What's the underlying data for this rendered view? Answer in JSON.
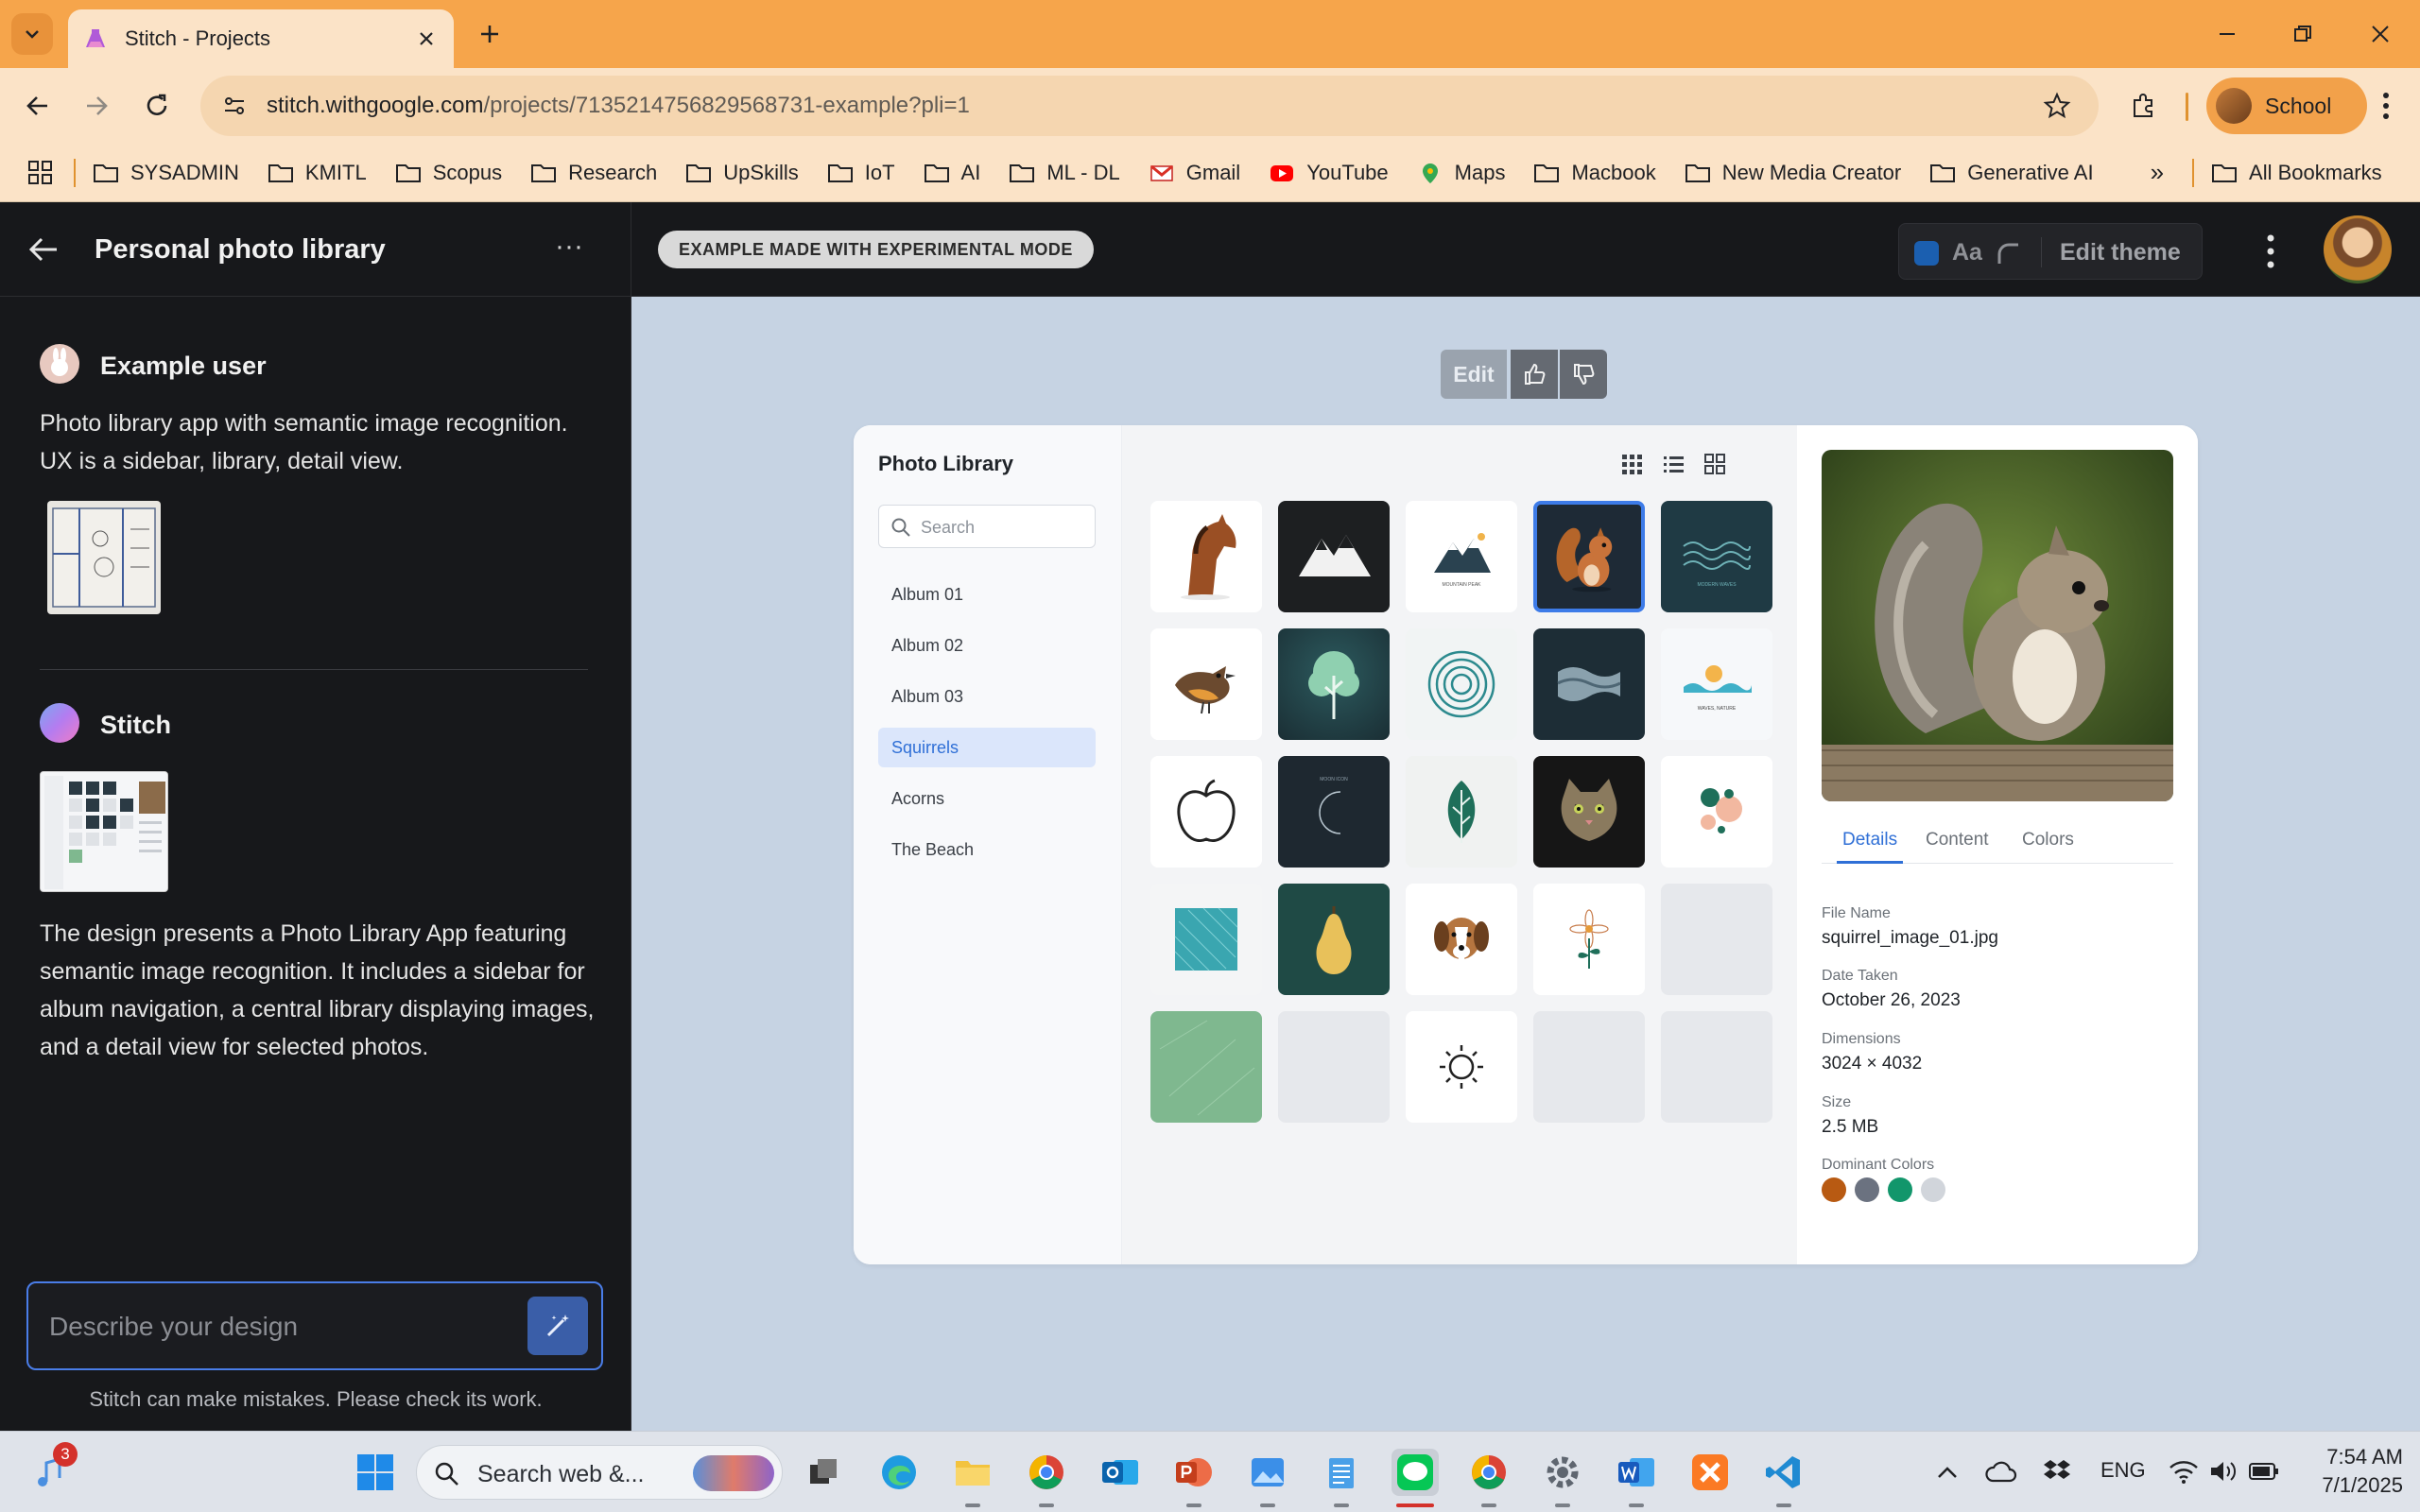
{
  "browser": {
    "tab_title": "Stitch - Projects",
    "url_host": "stitch.withgoogle.com",
    "url_path": "/projects/7135214756829568731-example?pli=1",
    "profile_label": "School",
    "bookmarks": [
      "SYSADMIN",
      "KMITL",
      "Scopus",
      "Research",
      "UpSkills",
      "IoT",
      "AI",
      "ML - DL",
      "Gmail",
      "YouTube",
      "Maps",
      "Macbook",
      "New Media Creator",
      "Generative AI"
    ],
    "more_bookmarks": "»",
    "all_bookmarks": "All Bookmarks"
  },
  "app": {
    "project_title": "Personal photo library",
    "more_label": "···",
    "experimental_badge": "EXAMPLE MADE WITH EXPERIMENTAL MODE",
    "theme_aa": "Aa",
    "edit_theme": "Edit theme"
  },
  "chat": {
    "user_name": "Example user",
    "user_message": "Photo library app with semantic image recognition. UX is a sidebar, library, detail view.",
    "bot_name": "Stitch",
    "bot_message": "The design presents a Photo Library App featuring semantic image recognition. It includes a sidebar for album navigation, a central library displaying images, and a detail view for selected photos.",
    "prompt_placeholder": "Describe your design",
    "disclaimer": "Stitch can make mistakes. Please check its work."
  },
  "canvas": {
    "edit_label": "Edit"
  },
  "photo_library": {
    "title": "Photo Library",
    "search_placeholder": "Search",
    "albums": [
      "Album 01",
      "Album 02",
      "Album 03",
      "Squirrels",
      "Acorns",
      "The Beach"
    ],
    "active_album": "Squirrels",
    "tiles": [
      "horse",
      "mountain-dark",
      "mountain-logo",
      "squirrel",
      "waves-dark",
      "bird",
      "tree",
      "spiral",
      "waves-grey",
      "sea-sun",
      "apple",
      "moon-dark",
      "leaf",
      "cat",
      "abstract",
      "texture-teal",
      "pear",
      "dog",
      "flower",
      "empty",
      "green-texture",
      "empty",
      "sun",
      "empty",
      "empty"
    ],
    "tile_captions": {
      "mountain-logo": "MOUNTAIN PEAK",
      "waves-dark": "MODERN WAVES",
      "sea-sun": "WAVES, NATURE",
      "moon-dark": "MOON ICON"
    },
    "selected_tile": "squirrel",
    "detail": {
      "tabs": [
        "Details",
        "Content",
        "Colors"
      ],
      "active_tab": "Details",
      "file_name_label": "File Name",
      "file_name": "squirrel_image_01.jpg",
      "date_label": "Date Taken",
      "date": "October 26, 2023",
      "dimensions_label": "Dimensions",
      "dimensions": "3024 × 4032",
      "size_label": "Size",
      "size": "2.5 MB",
      "colors_label": "Dominant Colors",
      "colors": [
        "#b85a12",
        "#6b7280",
        "#12966b",
        "#d1d5db"
      ]
    }
  },
  "taskbar": {
    "notif_count": "3",
    "search_text": "Search web &...",
    "lang": "ENG",
    "time": "7:54 AM",
    "date": "7/1/2025"
  },
  "colors": {
    "tab_bar": "#f6a54b",
    "accent_blue": "#2f6fd6",
    "app_dark": "#17181b"
  }
}
